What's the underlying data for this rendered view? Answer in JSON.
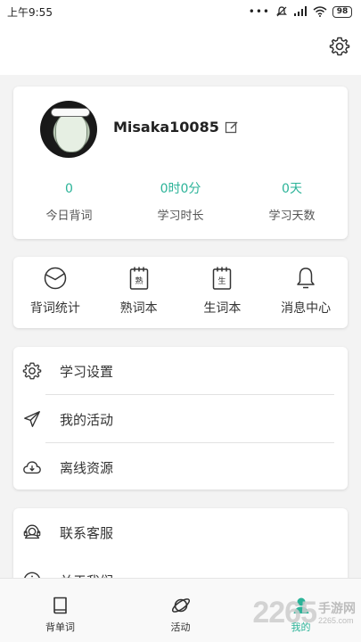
{
  "status_bar": {
    "time": "上午9:55",
    "icons": [
      "more-dots-icon",
      "mute-icon",
      "signal-icon",
      "wifi-icon",
      "battery-icon"
    ],
    "battery": "98"
  },
  "header": {
    "settings_icon": "gear-icon"
  },
  "profile": {
    "username": "Misaka10085",
    "edit_icon": "edit-icon",
    "stats": [
      {
        "value": "0",
        "label": "今日背词"
      },
      {
        "value": "0时0分",
        "label": "学习时长"
      },
      {
        "value": "0天",
        "label": "学习天数"
      }
    ]
  },
  "shortcuts": [
    {
      "label": "背词统计",
      "icon": "pie-chart-icon"
    },
    {
      "label": "熟词本",
      "icon": "notebook-familiar-icon",
      "glyph": "熟"
    },
    {
      "label": "生词本",
      "icon": "notebook-new-icon",
      "glyph": "生"
    },
    {
      "label": "消息中心",
      "icon": "bell-icon"
    }
  ],
  "menu": [
    {
      "label": "学习设置",
      "icon": "gear-icon"
    },
    {
      "label": "我的活动",
      "icon": "paper-plane-icon"
    },
    {
      "label": "离线资源",
      "icon": "cloud-download-icon"
    }
  ],
  "menu2": [
    {
      "label": "联系客服",
      "icon": "headset-icon"
    },
    {
      "label": "关于我们",
      "icon": "info-icon"
    }
  ],
  "tabs": [
    {
      "label": "背单词",
      "icon": "book-icon"
    },
    {
      "label": "活动",
      "icon": "planet-icon"
    },
    {
      "label": "我的",
      "icon": "user-icon"
    }
  ],
  "colors": {
    "accent": "#2bb398",
    "background": "#f3f3f3"
  }
}
